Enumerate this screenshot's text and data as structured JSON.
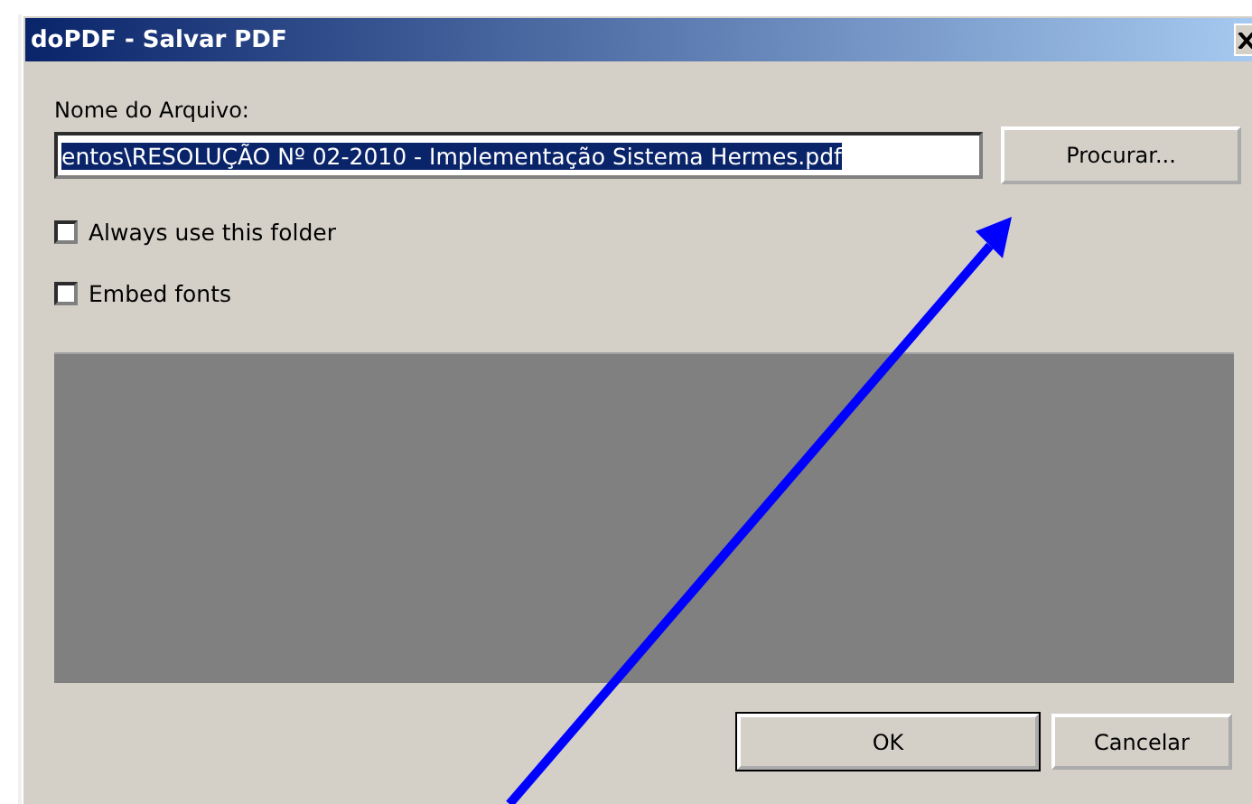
{
  "window": {
    "title": "doPDF - Salvar PDF"
  },
  "file_name": {
    "label": "Nome do Arquivo:",
    "value": "entos\\RESOLUÇÃO Nº 02-2010 - Implementação Sistema Hermes.pdf",
    "selected": true
  },
  "browse_button": "Procurar...",
  "options": [
    {
      "label": "Always use this folder",
      "checked": false
    },
    {
      "label": "Embed fonts",
      "checked": false
    }
  ],
  "buttons": [
    {
      "label": "OK",
      "default": true
    },
    {
      "label": "Cancelar",
      "default": false
    }
  ]
}
